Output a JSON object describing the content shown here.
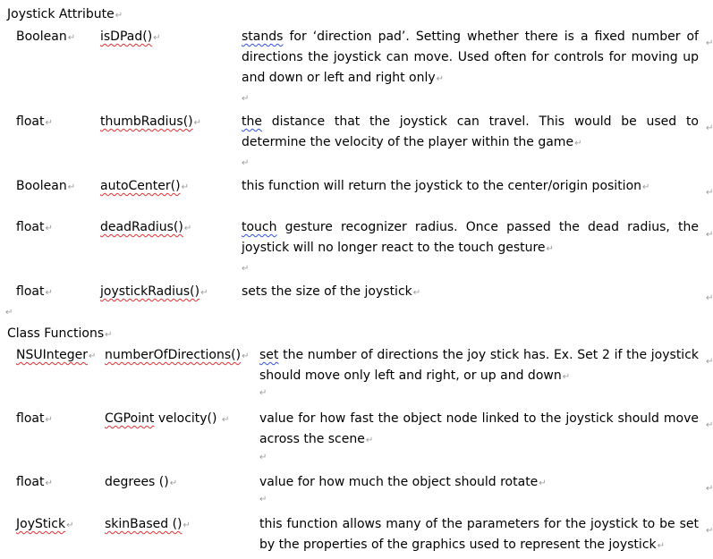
{
  "joystick_attribute": {
    "heading": "Joystick Attribute",
    "rows": [
      {
        "type": "Boolean",
        "name": "isDPad()",
        "desc_first": "stands",
        "desc_rest": " for ‘direction pad’. Setting whether there is a fixed number of directions the joystick can move. Used often for controls for moving up and down or left and right only"
      },
      {
        "type": "float",
        "name": "thumbRadius()",
        "desc_first": "the",
        "desc_rest": " distance that the joystick can travel. This would be used to determine the velocity of the player within the game"
      },
      {
        "type": "Boolean",
        "name": "autoCenter()",
        "desc_first": "",
        "desc_rest": "this function will return the joystick to the center/origin position"
      },
      {
        "type": "float",
        "name": "deadRadius()",
        "desc_first": "touch",
        "desc_rest": " gesture recognizer radius. Once passed the dead radius, the joystick will no longer react to the touch gesture"
      },
      {
        "type": "float",
        "name": "joystickRadius()",
        "desc_first": "",
        "desc_rest": "sets the size of the joystick"
      }
    ]
  },
  "class_functions": {
    "heading": "Class Functions",
    "rows": [
      {
        "type": "NSUInteger",
        "name": "numberOfDirections()",
        "name_prefix": "",
        "desc_first": "set",
        "desc_rest": " the number of directions the joy stick has. Ex. Set 2 if the joystick should move only left and right, or up and down"
      },
      {
        "type": "float",
        "name": "velocity()",
        "name_prefix": "CGPoint",
        "desc_first": "",
        "desc_rest": "value for how fast the object node linked to the joystick should move across the scene"
      },
      {
        "type": "float",
        "name": "degrees ()",
        "name_prefix": "",
        "desc_first": "",
        "desc_rest": "value for how much the object should rotate"
      },
      {
        "type": "JoyStick",
        "name": "skinBased ()",
        "name_prefix": "",
        "desc_first": "",
        "desc_rest": "this function allows many of the parameters for the joystick to be set by the properties of the graphics used to represent the joystick"
      }
    ]
  },
  "icons": {
    "paragraph_mark": "return-arrow-icon"
  }
}
